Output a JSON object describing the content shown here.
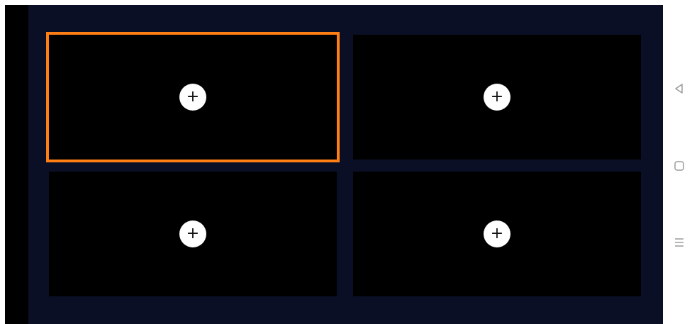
{
  "top_caption": "",
  "accent_color": "#ff7f15",
  "screen_background": "#0b0f26",
  "slots": [
    {
      "label": "+",
      "selected": true
    },
    {
      "label": "+",
      "selected": false
    },
    {
      "label": "+",
      "selected": false
    },
    {
      "label": "+",
      "selected": false
    }
  ],
  "nav": {
    "icons": [
      "back-triangle-icon",
      "home-square-icon",
      "menu-lines-icon"
    ]
  }
}
